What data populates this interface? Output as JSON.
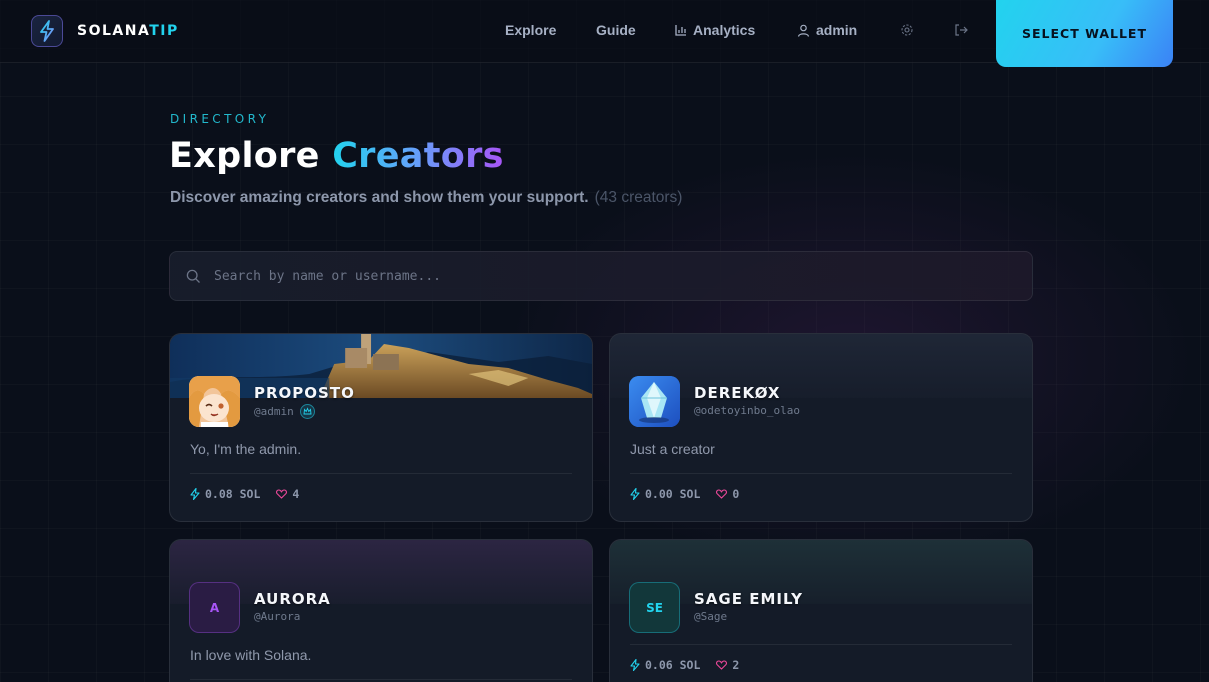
{
  "header": {
    "logo_main": "SOLANA",
    "logo_accent": "TIP",
    "nav": {
      "explore": "Explore",
      "guide": "Guide",
      "analytics": "Analytics",
      "user": "admin"
    },
    "wallet_button": "SELECT WALLET"
  },
  "hero": {
    "eyebrow": "DIRECTORY",
    "title_plain": "Explore",
    "title_accent": "Creators",
    "subtitle": "Discover amazing creators and show them your support.",
    "count": "(43 creators)"
  },
  "search": {
    "placeholder": "Search by name or username..."
  },
  "creators": [
    {
      "name": "PROPOSTO",
      "handle": "@admin",
      "bio": "Yo, I'm the admin.",
      "sol": "0.08 SOL",
      "likes": "4",
      "avatar": "anime-avatar",
      "banner": "coastal-village-photo"
    },
    {
      "name": "DEREKØX",
      "handle": "@odetoyinbo_olao",
      "bio": "Just a creator",
      "sol": "0.00 SOL",
      "likes": "0",
      "avatar": "crystal-avatar"
    },
    {
      "name": "AURORA",
      "handle": "@Aurora",
      "bio": "In love with Solana.",
      "initials": "A"
    },
    {
      "name": "SAGE EMILY",
      "handle": "@Sage",
      "sol": "0.06 SOL",
      "likes": "2",
      "initials": "SE"
    }
  ],
  "colors": {
    "background": "#0a0f1a",
    "accent_cyan": "#22d3ee",
    "accent_purple": "#a855f7",
    "like_pink": "#ec4899"
  }
}
